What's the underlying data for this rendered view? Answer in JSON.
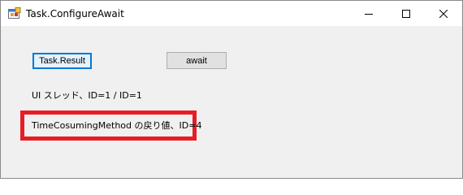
{
  "window": {
    "title": "Task.ConfigureAwait",
    "icon": "winforms-app-icon"
  },
  "caption_buttons": {
    "minimize_icon": "minimize-icon",
    "maximize_icon": "maximize-icon",
    "close_icon": "close-icon"
  },
  "buttons": {
    "task_result_label": "Task.Result",
    "await_label": "await"
  },
  "labels": {
    "thread_info": "UI スレッド、ID=1 / ID=1",
    "method_return": "TimeCosumingMethod の戻り値、ID=4"
  },
  "colors": {
    "highlight_border": "#e81c24",
    "focus_border": "#0078d7"
  }
}
